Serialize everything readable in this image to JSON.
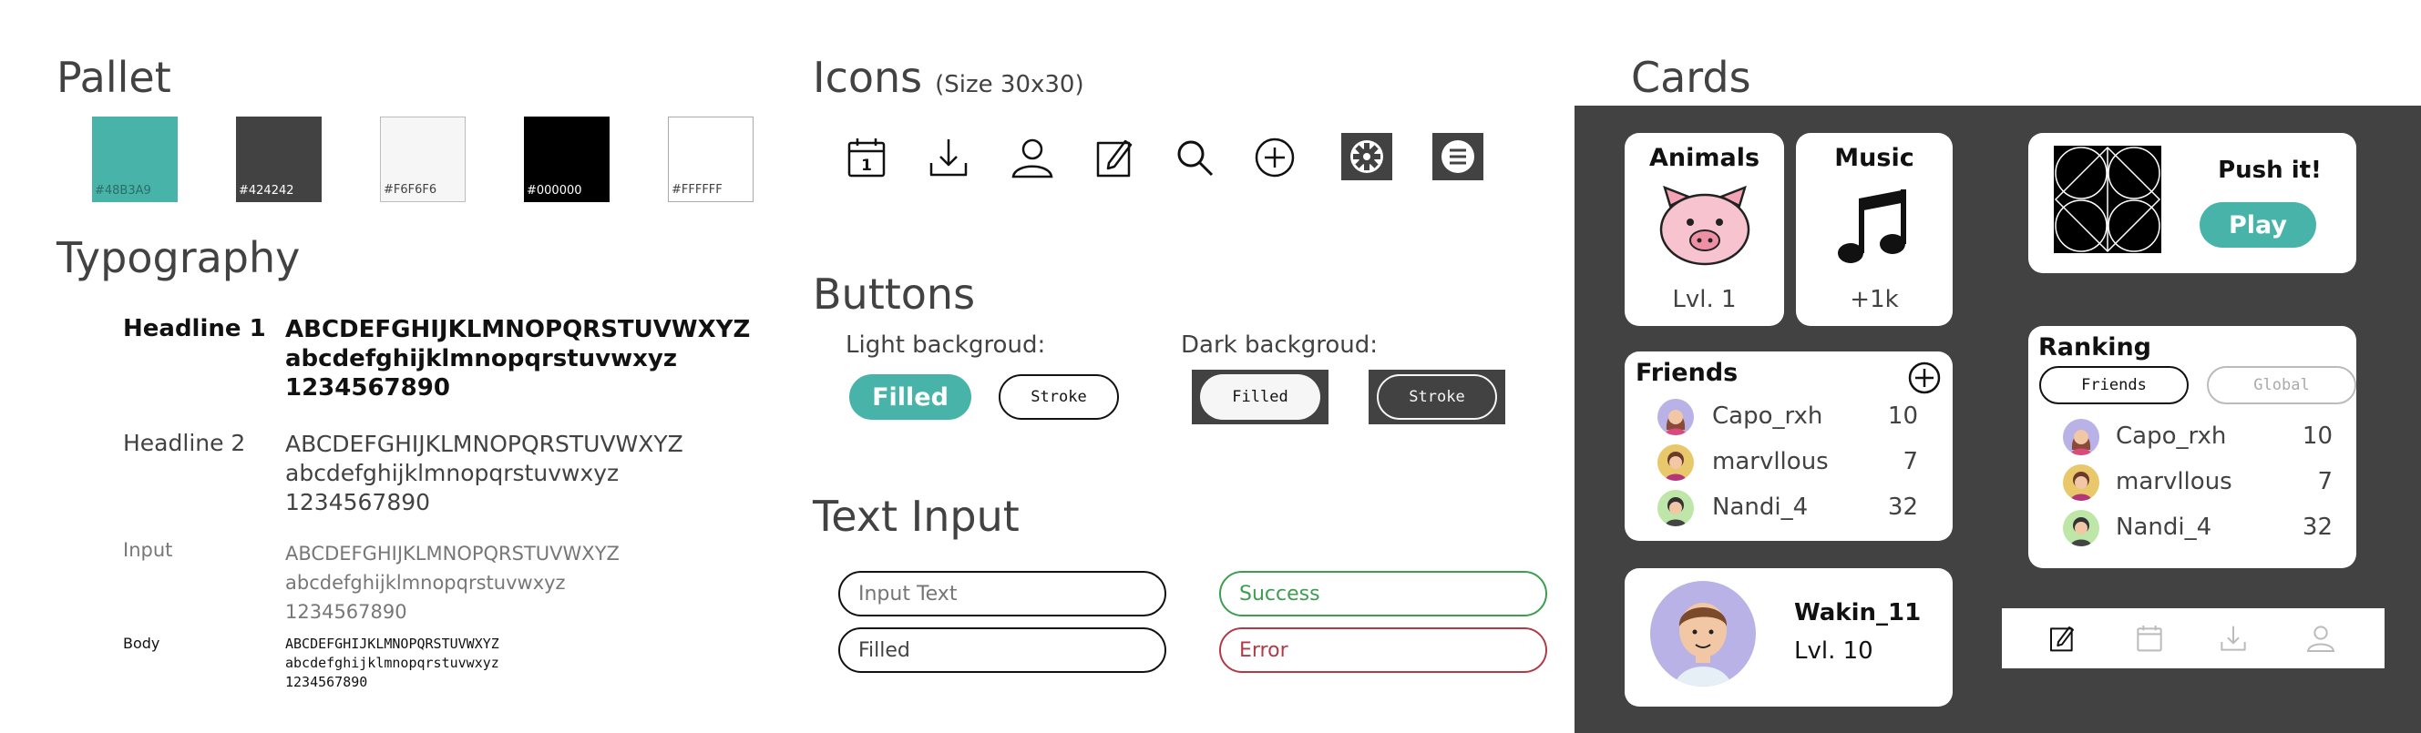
{
  "palette": {
    "title": "Pallet",
    "swatches": [
      {
        "label": "#48B3A9",
        "color": "#48B3A9"
      },
      {
        "label": "#424242",
        "color": "#424242"
      },
      {
        "label": "#F6F6F6",
        "color": "#F6F6F6"
      },
      {
        "label": "#000000",
        "color": "#000000"
      },
      {
        "label": "#FFFFFF",
        "color": "#FFFFFF"
      }
    ]
  },
  "typography": {
    "title": "Typography",
    "rows": [
      {
        "label": "Headline 1",
        "upper": "ABCDEFGHIJKLMNOPQRSTUVWXYZ",
        "lower": "abcdefghijklmnopqrstuvwxyz",
        "digits": "1234567890"
      },
      {
        "label": "Headline 2",
        "upper": "ABCDEFGHIJKLMNOPQRSTUVWXYZ",
        "lower": "abcdefghijklmnopqrstuvwxyz",
        "digits": "1234567890"
      },
      {
        "label": "Input",
        "upper": "ABCDEFGHIJKLMNOPQRSTUVWXYZ",
        "lower": "abcdefghijklmnopqrstuvwxyz",
        "digits": "1234567890"
      },
      {
        "label": "Body",
        "upper": "ABCDEFGHIJKLMNOPQRSTUVWXYZ",
        "lower": "abcdefghijklmnopqrstuvwxyz",
        "digits": "1234567890"
      }
    ]
  },
  "icons": {
    "title": "Icons",
    "subtitle": "(Size 30x30)",
    "calendar_day": "1",
    "items": [
      "calendar-icon",
      "download-icon",
      "user-icon",
      "edit-icon",
      "search-icon",
      "add-circle-icon",
      "gear-icon",
      "menu-icon"
    ]
  },
  "buttons": {
    "title": "Buttons",
    "light_label": "Light backgroud:",
    "dark_label": "Dark backgroud:",
    "light_filled": "Filled",
    "light_stroke": "Stroke",
    "dark_filled": "Filled",
    "dark_stroke": "Stroke"
  },
  "text_input": {
    "title": "Text Input",
    "input_placeholder": "Input Text",
    "filled_value": "Filled",
    "success_value": "Success",
    "error_value": "Error"
  },
  "cards": {
    "title": "Cards",
    "animals": {
      "title": "Animals",
      "level": "Lvl. 1"
    },
    "music": {
      "title": "Music",
      "count": "+1k"
    },
    "push": {
      "title": "Push it!",
      "button": "Play"
    },
    "friends": {
      "title": "Friends",
      "rows": [
        {
          "name": "Capo_rxh",
          "score": "10"
        },
        {
          "name": "marvllous",
          "score": "7"
        },
        {
          "name": "Nandi_4",
          "score": "32"
        }
      ]
    },
    "ranking": {
      "title": "Ranking",
      "tab_friends": "Friends",
      "tab_global": "Global",
      "rows": [
        {
          "name": "Capo_rxh",
          "score": "10"
        },
        {
          "name": "marvllous",
          "score": "7"
        },
        {
          "name": "Nandi_4",
          "score": "32"
        }
      ]
    },
    "profile": {
      "name": "Wakin_11",
      "level": "Lvl. 10"
    },
    "bottom_nav": [
      "edit-icon",
      "calendar-icon",
      "download-icon",
      "user-icon"
    ]
  },
  "colors": {
    "accent": "#48B3A9",
    "dark": "#424242",
    "light": "#F6F6F6",
    "success": "#3C9E4E",
    "error": "#B03A48"
  }
}
